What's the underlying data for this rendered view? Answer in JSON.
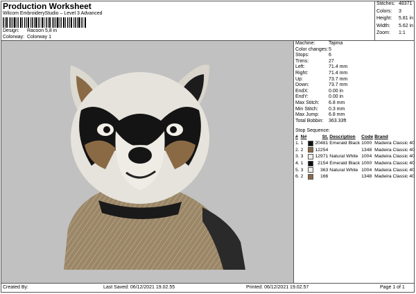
{
  "header": {
    "title": "Production Worksheet",
    "subtitle": "Wilcom EmbroideryStudio – Level 3 Advanced",
    "design_label": "Design:",
    "design_value": "Racoon 5,8 in",
    "colorway_label": "Colorway:",
    "colorway_value": "Colorway 1"
  },
  "stats": [
    {
      "label": "Stitches:",
      "value": "48371"
    },
    {
      "label": "Colors:",
      "value": "3"
    },
    {
      "label": "Height:",
      "value": "5.81 in"
    },
    {
      "label": "Width:",
      "value": "5.62 in"
    },
    {
      "label": "Zoom:",
      "value": "1:1"
    }
  ],
  "machine": [
    {
      "label": "Machine:",
      "value": "Tajima"
    },
    {
      "label": "Color changes:",
      "value": "5"
    },
    {
      "label": "Stops:",
      "value": "6"
    },
    {
      "label": "Trims:",
      "value": "27"
    },
    {
      "label": "Left:",
      "value": "71.4 mm"
    },
    {
      "label": "Right:",
      "value": "71.4 mm"
    },
    {
      "label": "Up:",
      "value": "73.7 mm"
    },
    {
      "label": "Down:",
      "value": "73.7 mm"
    },
    {
      "label": "EndX:",
      "value": "0.00 in"
    },
    {
      "label": "EndY:",
      "value": "0.00 in"
    },
    {
      "label": "Max Stitch:",
      "value": "6.8 mm"
    },
    {
      "label": "Min Stitch:",
      "value": "0.3 mm"
    },
    {
      "label": "Max Jump:",
      "value": "6.8 mm"
    },
    {
      "label": "Total Bobbin:",
      "value": "363.33ft"
    }
  ],
  "stop_sequence": {
    "title": "Stop Sequence:",
    "headers": [
      "#",
      "N#",
      "St.",
      "Description",
      "Code",
      "Brand"
    ],
    "rows": [
      {
        "idx": "1.",
        "n": "1",
        "color": "#111111",
        "st": "20481",
        "desc": "Emerald Black",
        "code": "1000",
        "brand": "Madeira Classic 40"
      },
      {
        "idx": "2.",
        "n": "2",
        "color": "#8a6a45",
        "st": "12254",
        "desc": "",
        "code": "1348",
        "brand": "Madeira Classic 40"
      },
      {
        "idx": "3.",
        "n": "3",
        "color": "#eeeeea",
        "st": "12971",
        "desc": "Natural White",
        "code": "1004",
        "brand": "Madeira Classic 40"
      },
      {
        "idx": "4.",
        "n": "1",
        "color": "#111111",
        "st": "2154",
        "desc": "Emerald Black",
        "code": "1000",
        "brand": "Madeira Classic 40"
      },
      {
        "idx": "5.",
        "n": "3",
        "color": "#eeeeea",
        "st": "363",
        "desc": "Natural White",
        "code": "1004",
        "brand": "Madeira Classic 40"
      },
      {
        "idx": "6.",
        "n": "2",
        "color": "#8a6a45",
        "st": "166",
        "desc": "",
        "code": "1348",
        "brand": "Madeira Classic 40"
      }
    ]
  },
  "footer": {
    "created_by": "Created By:",
    "last_saved": "Last Saved: 06/12/2021 19.02.55",
    "printed": "Printed: 06/12/2021 19.02.57",
    "page": "Page 1 of 1"
  },
  "colors": {
    "background": "#c1c1c1",
    "black": "#111111",
    "brown": "#8a6a45",
    "white": "#eeeeea"
  }
}
